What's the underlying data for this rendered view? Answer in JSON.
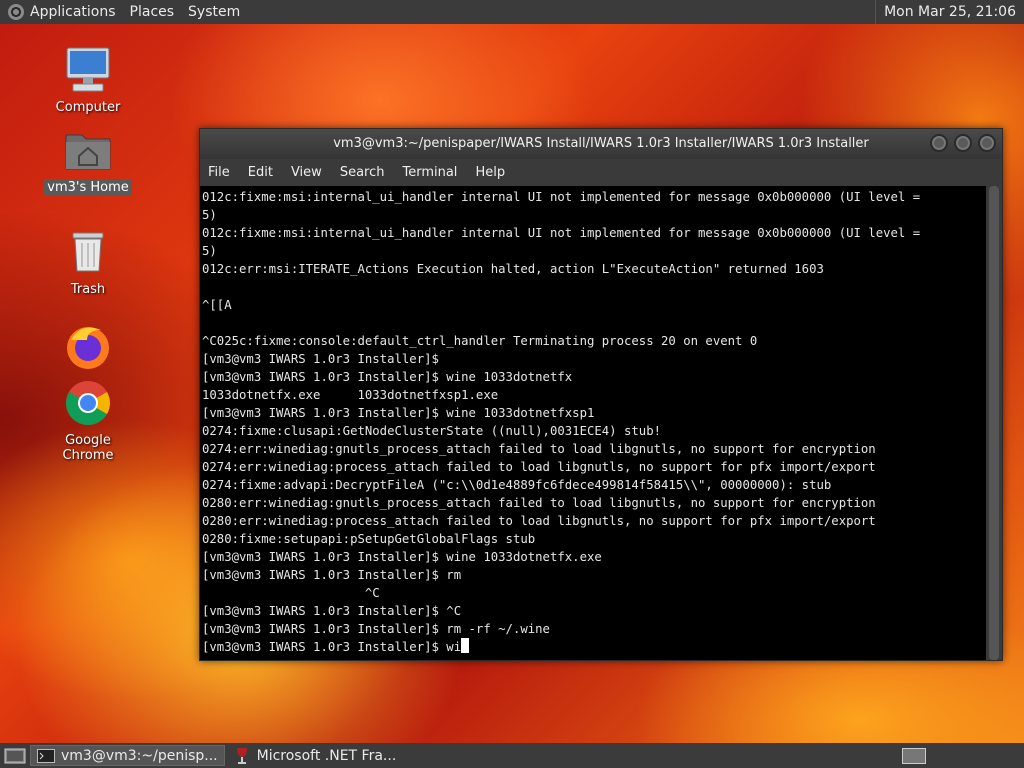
{
  "top_panel": {
    "menus": [
      "Applications",
      "Places",
      "System"
    ],
    "clock": "Mon Mar 25, 21:06"
  },
  "desktop_icons": [
    {
      "label": "Computer",
      "icon": "computer-icon"
    },
    {
      "label": "vm3's Home",
      "icon": "home-folder-icon"
    },
    {
      "label": "Trash",
      "icon": "trash-icon"
    },
    {
      "label": "Firefox",
      "icon": "firefox-icon"
    },
    {
      "label": "Google Chrome",
      "icon": "chrome-icon"
    }
  ],
  "window": {
    "title": "vm3@vm3:~/penispaper/IWARS Install/IWARS 1.0r3 Installer/IWARS 1.0r3 Installer",
    "menus": [
      "File",
      "Edit",
      "View",
      "Search",
      "Terminal",
      "Help"
    ]
  },
  "terminal": {
    "lines": [
      "012c:fixme:msi:internal_ui_handler internal UI not implemented for message 0x0b000000 (UI level =",
      "5)",
      "012c:fixme:msi:internal_ui_handler internal UI not implemented for message 0x0b000000 (UI level =",
      "5)",
      "012c:err:msi:ITERATE_Actions Execution halted, action L\"ExecuteAction\" returned 1603",
      "",
      "^[[A",
      "",
      "^C025c:fixme:console:default_ctrl_handler Terminating process 20 on event 0",
      "[vm3@vm3 IWARS 1.0r3 Installer]$",
      "[vm3@vm3 IWARS 1.0r3 Installer]$ wine 1033dotnetfx",
      "1033dotnetfx.exe     1033dotnetfxsp1.exe",
      "[vm3@vm3 IWARS 1.0r3 Installer]$ wine 1033dotnetfxsp1",
      "0274:fixme:clusapi:GetNodeClusterState ((null),0031ECE4) stub!",
      "0274:err:winediag:gnutls_process_attach failed to load libgnutls, no support for encryption",
      "0274:err:winediag:process_attach failed to load libgnutls, no support for pfx import/export",
      "0274:fixme:advapi:DecryptFileA (\"c:\\\\0d1e4889fc6fdece499814f58415\\\\\", 00000000): stub",
      "0280:err:winediag:gnutls_process_attach failed to load libgnutls, no support for encryption",
      "0280:err:winediag:process_attach failed to load libgnutls, no support for pfx import/export",
      "0280:fixme:setupapi:pSetupGetGlobalFlags stub",
      "[vm3@vm3 IWARS 1.0r3 Installer]$ wine 1033dotnetfx.exe",
      "[vm3@vm3 IWARS 1.0r3 Installer]$ rm",
      "                      ^C",
      "[vm3@vm3 IWARS 1.0r3 Installer]$ ^C",
      "[vm3@vm3 IWARS 1.0r3 Installer]$ rm -rf ~/.wine"
    ],
    "current_line": "[vm3@vm3 IWARS 1.0r3 Installer]$ wi"
  },
  "taskbar": {
    "tasks": [
      {
        "label": "vm3@vm3:~/penisp...",
        "icon": "terminal-icon"
      },
      {
        "label": "Microsoft .NET Fra...",
        "icon": "wine-icon"
      }
    ]
  }
}
